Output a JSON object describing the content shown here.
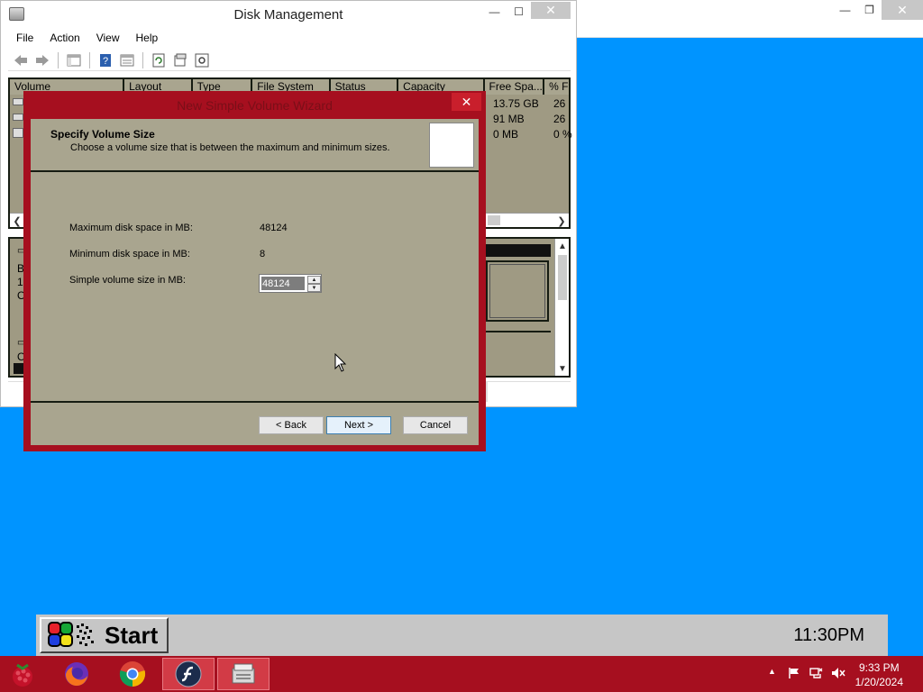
{
  "background_window": {
    "buttons": {
      "minimize": "—",
      "restore": "❐",
      "close": "✕"
    }
  },
  "disk_management": {
    "title": "Disk Management",
    "caption": {
      "minimize": "—",
      "maximize": "☐",
      "close": "✕"
    },
    "menu": [
      "File",
      "Action",
      "View",
      "Help"
    ],
    "columns": [
      "Volume",
      "Layout",
      "Type",
      "File System",
      "Status",
      "Capacity",
      "Free Spa...",
      "% F"
    ],
    "volumes": [
      {
        "free": "13.75 GB",
        "pct": "26"
      },
      {
        "free": "91 MB",
        "pct": "26"
      },
      {
        "free": "0 MB",
        "pct": "0 %"
      }
    ],
    "disk_pane_fragments": [
      "B",
      "1",
      "O",
      "O"
    ]
  },
  "wizard": {
    "title": "New Simple Volume Wizard",
    "close": "✕",
    "header_title": "Specify Volume Size",
    "header_subtitle": "Choose a volume size that is between the maximum and minimum sizes.",
    "max_label": "Maximum disk space in MB:",
    "max_value": "48124",
    "min_label": "Minimum disk space in MB:",
    "min_value": "8",
    "size_label": "Simple volume size in MB:",
    "size_value": "48124",
    "back": "< Back",
    "next": "Next >",
    "cancel": "Cancel"
  },
  "start_bar": {
    "start_label": "Start",
    "clock": "11:30PM"
  },
  "taskbar": {
    "time": "9:33 PM",
    "date": "1/20/2024",
    "icons": [
      "raspberry-icon",
      "firefox-icon",
      "chrome-icon",
      "flash-icon",
      "disk-management-icon"
    ]
  },
  "colors": {
    "desktop": "#0094ff",
    "taskbar": "#a60f1f",
    "pane": "#9f9a83",
    "dialog_face": "#a9a58f"
  }
}
